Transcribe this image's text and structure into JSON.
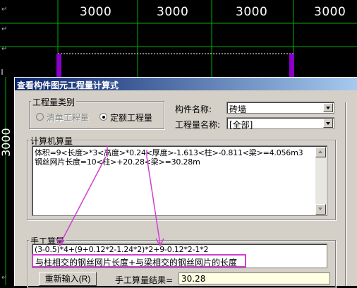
{
  "cad": {
    "dimensions": [
      "3000",
      "3000",
      "3000",
      "3000"
    ],
    "vertical_dimension": "3000",
    "marks": [
      "↵",
      "↵",
      "↵",
      "↵"
    ]
  },
  "dialog": {
    "title": "查看构件图元工程量计算式",
    "quantity_category": {
      "label": "工程量类别",
      "options": [
        "清单工程量",
        "定额工程量"
      ],
      "selected": "定额工程量"
    },
    "component_name_label": "构件名称:",
    "component_name_value": "砖墙",
    "quantity_name_label": "工程量名称:",
    "quantity_name_value": "[全部]",
    "computer_calc": {
      "label": "计算机算量",
      "lines": [
        "体积=9<长度>*3<高度>*0.24<厚度>-1.613<柱>-0.811<梁>=4.056m3",
        "钢丝网片长度=10<柱>+20.28<梁>=30.28m"
      ]
    },
    "manual_calc": {
      "label": "手工算量",
      "formula": "(3-0.5)*4+(9+0.12*2-1.24*2)*2+9-0.12*2-1*2",
      "annotation": "与柱相交的钢丝网片长度+与梁相交的钢丝网片的长度"
    },
    "reenter_button": "重新输入(R)",
    "result_label": "手工算量结果=",
    "result_value": "30.28"
  },
  "colors": {
    "annotation_magenta": "#d040d0",
    "grid_green": "#00b000",
    "wall_purple": "#8a00c8",
    "titlebar": "#0a246a"
  }
}
